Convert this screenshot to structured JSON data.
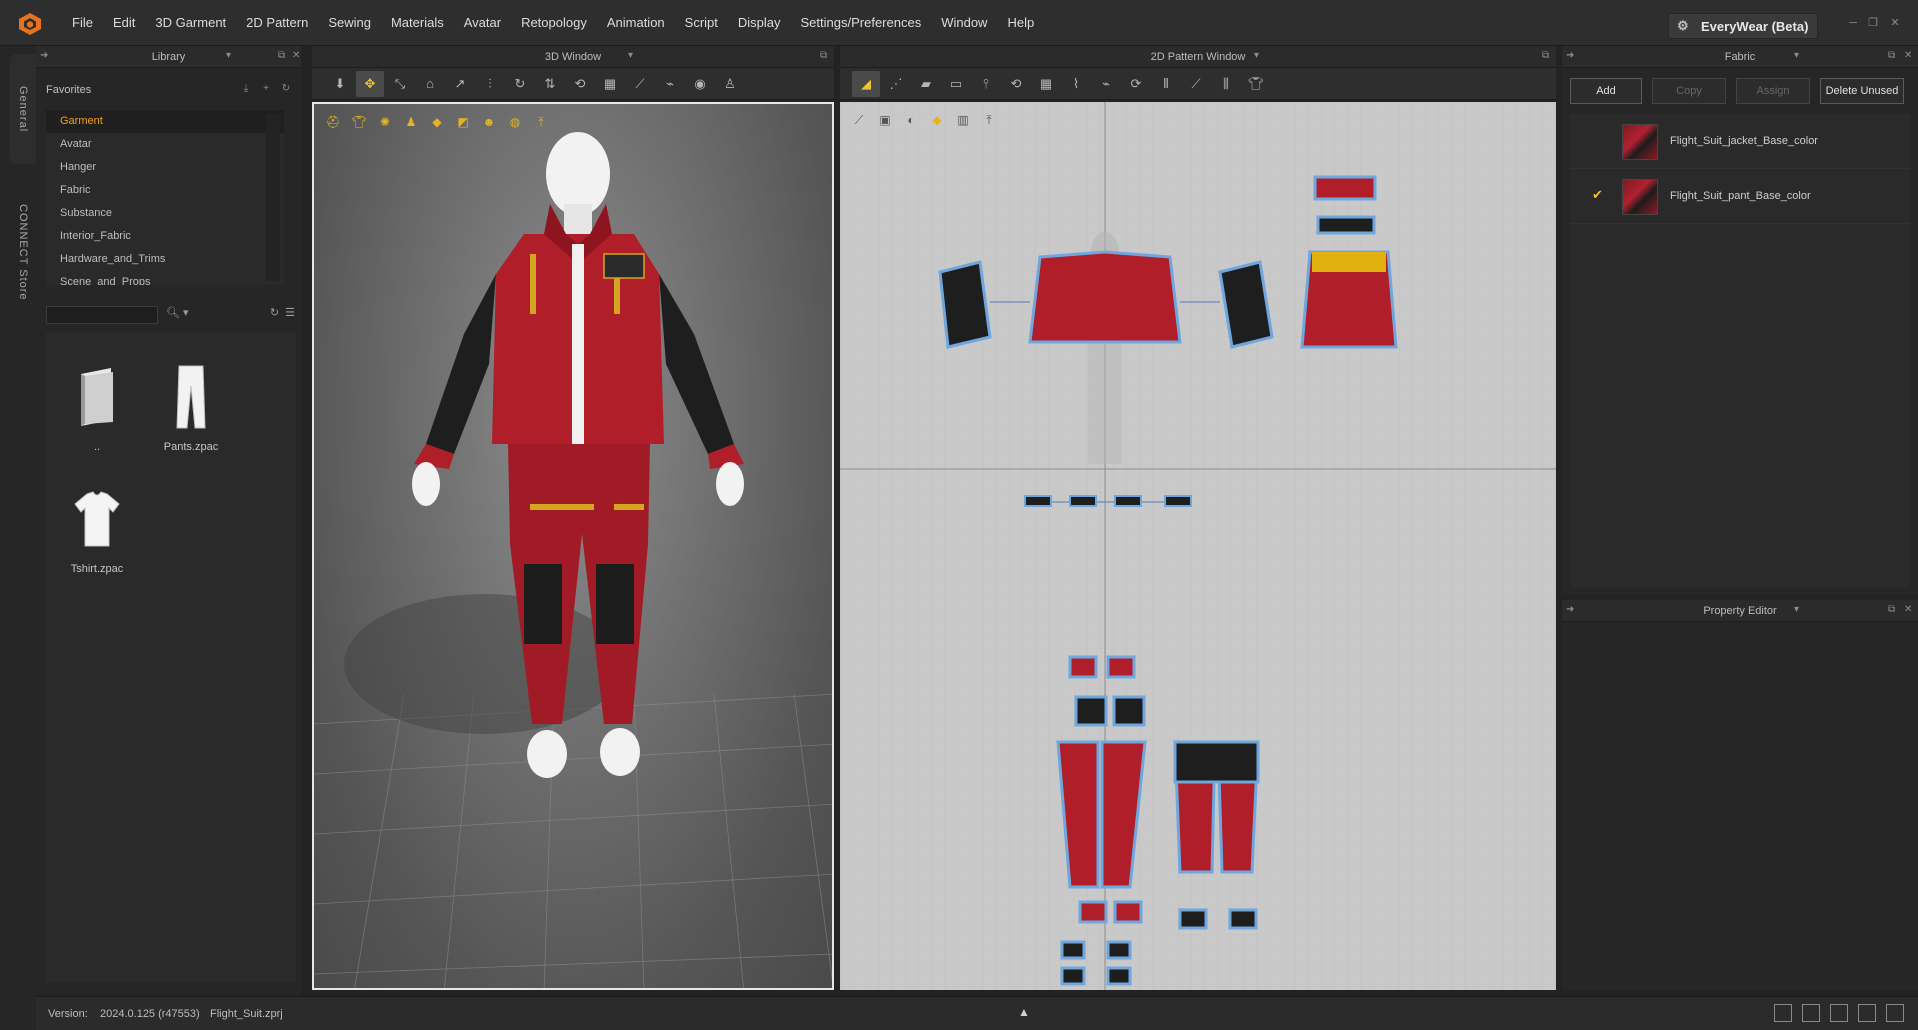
{
  "menu": [
    "File",
    "Edit",
    "3D Garment",
    "2D Pattern",
    "Sewing",
    "Materials",
    "Avatar",
    "Retopology",
    "Animation",
    "Script",
    "Display",
    "Settings/Preferences",
    "Window",
    "Help"
  ],
  "brand": {
    "label": "EveryWear (Beta)",
    "icon": "everywear-icon"
  },
  "side_tabs": [
    "General",
    "CONNECT Store"
  ],
  "library": {
    "title": "Library",
    "favorites_title": "Favorites",
    "favorites": [
      "Garment",
      "Avatar",
      "Hanger",
      "Fabric",
      "Substance",
      "Interior_Fabric",
      "Hardware_and_Trims",
      "Scene_and_Props"
    ],
    "selected_favorite": "Garment",
    "search_value": "",
    "files": [
      {
        "name": "..",
        "icon": "folder-up-icon"
      },
      {
        "name": "Pants.zpac",
        "icon": "pants-icon"
      },
      {
        "name": "Tshirt.zpac",
        "icon": "tshirt-icon"
      }
    ]
  },
  "window3d": {
    "title": "3D Window"
  },
  "window2d": {
    "title": "2D Pattern Window"
  },
  "fabric": {
    "title": "Fabric",
    "buttons": {
      "add": "Add",
      "copy": "Copy",
      "assign": "Assign",
      "delete_unused": "Delete Unused"
    },
    "items": [
      {
        "name": "Flight_Suit_jacket_Base_color",
        "checked": false
      },
      {
        "name": "Flight_Suit_pant_Base_color",
        "checked": true
      }
    ]
  },
  "property_editor": {
    "title": "Property Editor"
  },
  "status": {
    "version_label": "Version:",
    "version_value": "2024.0.125 (r47553)",
    "file_name": "Flight_Suit.zprj"
  },
  "colors": {
    "accent": "#f1c232",
    "selected_text": "#f0a020",
    "garment_red": "#b01e2a",
    "panel_bg": "#262626"
  }
}
